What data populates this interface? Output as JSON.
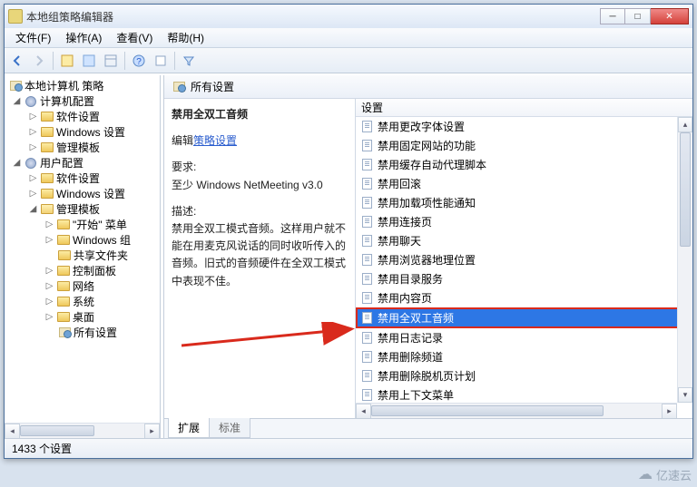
{
  "window": {
    "title": "本地组策略编辑器"
  },
  "menu": {
    "file": "文件(F)",
    "action": "操作(A)",
    "view": "查看(V)",
    "help": "帮助(H)"
  },
  "tree": {
    "root": "本地计算机 策略",
    "c1": "计算机配置",
    "c1a": "软件设置",
    "c1b": "Windows 设置",
    "c1c": "管理模板",
    "c2": "用户配置",
    "c2a": "软件设置",
    "c2b": "Windows 设置",
    "c2c": "管理模板",
    "t1": "\"开始\" 菜单",
    "t2": "Windows 组",
    "t3": "共享文件夹",
    "t4": "控制面板",
    "t5": "网络",
    "t6": "系统",
    "t7": "桌面",
    "t8": "所有设置"
  },
  "header": "所有设置",
  "info": {
    "title": "禁用全双工音频",
    "edit_prefix": "编辑",
    "edit_link": "策略设置",
    "req_label": "要求:",
    "req": "至少 Windows NetMeeting v3.0",
    "desc_label": "描述:",
    "desc": "禁用全双工模式音频。这样用户就不能在用麦克风说话的同时收听传入的音频。旧式的音频硬件在全双工模式中表现不佳。"
  },
  "list": {
    "col": "设置",
    "items": [
      "禁用更改字体设置",
      "禁用固定网站的功能",
      "禁用缓存自动代理脚本",
      "禁用回滚",
      "禁用加载项性能通知",
      "禁用连接页",
      "禁用聊天",
      "禁用浏览器地理位置",
      "禁用目录服务",
      "禁用内容页",
      "禁用全双工音频",
      "禁用日志记录",
      "禁用删除频道",
      "禁用删除脱机页计划",
      "禁用上下文菜单"
    ],
    "sel": 10
  },
  "tabs": {
    "ext": "扩展",
    "std": "标准"
  },
  "status": "1433 个设置",
  "brand": "亿速云"
}
